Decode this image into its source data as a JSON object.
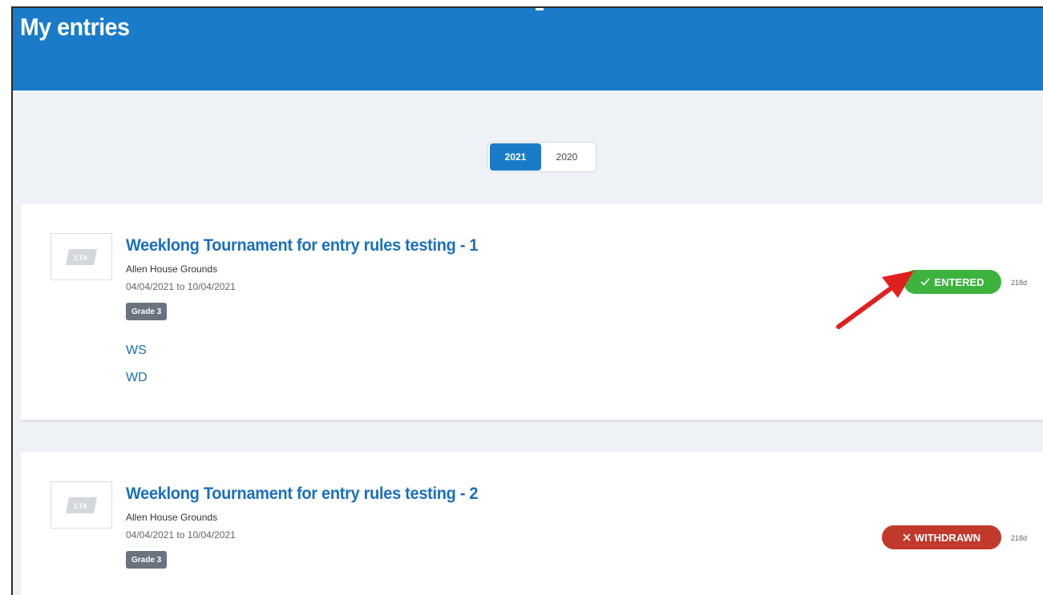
{
  "header": {
    "title": "My entries"
  },
  "year_toggle": {
    "options": [
      {
        "label": "2021",
        "active": true
      },
      {
        "label": "2020",
        "active": false
      }
    ]
  },
  "entries": [
    {
      "logo": "LTA",
      "title": "Weeklong Tournament for entry rules testing - 1",
      "venue": "Allen House Grounds",
      "date_start": "04/04/2021",
      "date_sep": "to",
      "date_end": "10/04/2021",
      "grade": "Grade 3",
      "events": [
        "WS",
        "WD"
      ],
      "status": "ENTERED",
      "status_icon": "check-icon",
      "age": "218d"
    },
    {
      "logo": "LTA",
      "title": "Weeklong Tournament for entry rules testing - 2",
      "venue": "Allen House Grounds",
      "date_start": "04/04/2021",
      "date_sep": "to",
      "date_end": "10/04/2021",
      "grade": "Grade 3",
      "status": "WITHDRAWN",
      "status_icon": "close-icon",
      "age": "218d"
    }
  ],
  "colors": {
    "header": "#1a7cc8",
    "link": "#1a6fbf",
    "entered": "#3db33e",
    "withdrawn": "#c0392b",
    "grade_badge": "#6b7280",
    "annotation_arrow": "#e02020"
  }
}
